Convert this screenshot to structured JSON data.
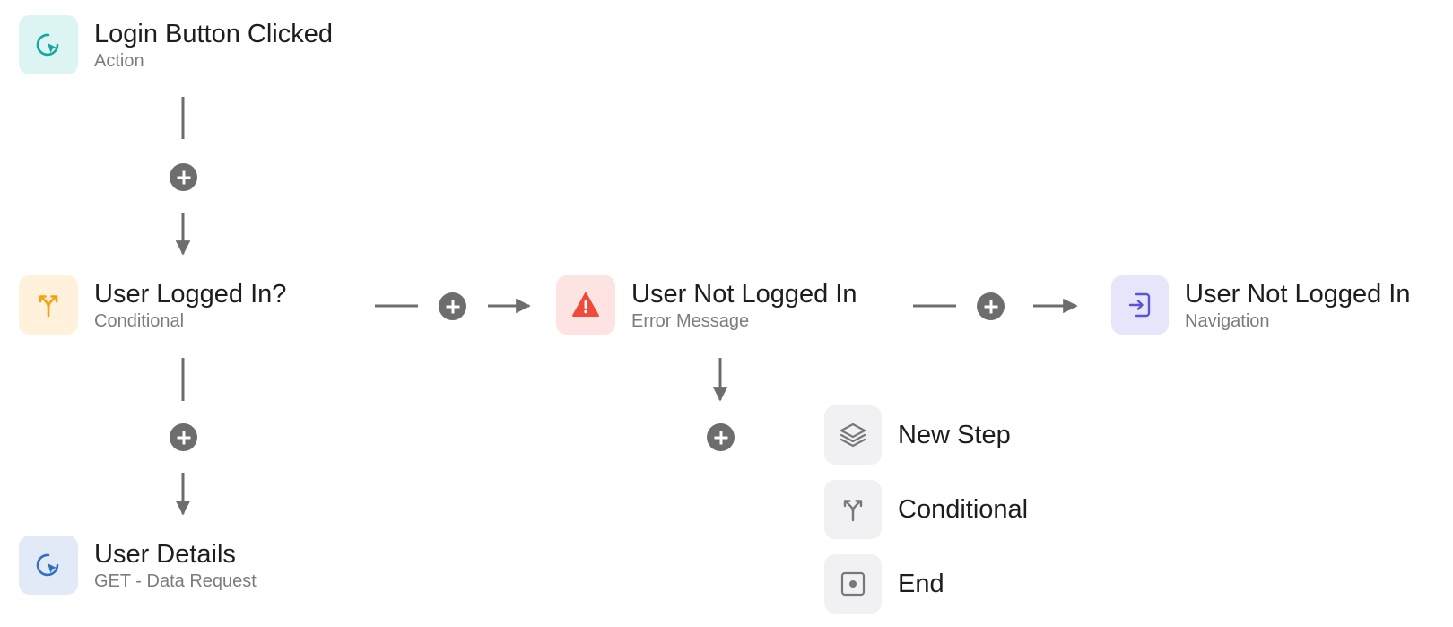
{
  "nodes": {
    "login_clicked": {
      "title": "Login Button Clicked",
      "subtitle": "Action",
      "icon": "cursor-click-icon",
      "icon_color": "#14a6a1",
      "icon_bg": "#dcf4f2"
    },
    "user_logged_in": {
      "title": "User Logged In?",
      "subtitle": "Conditional",
      "icon": "branch-icon",
      "icon_color": "#f5a010",
      "icon_bg": "#fff1dc"
    },
    "user_not_logged_in_error": {
      "title": "User Not Logged In",
      "subtitle": "Error Message",
      "icon": "warning-icon",
      "icon_color": "#ef4a3a",
      "icon_bg": "#fde3e1"
    },
    "user_not_logged_in_nav": {
      "title": "User Not Logged In",
      "subtitle": "Navigation",
      "icon": "sign-in-icon",
      "icon_color": "#5a55d6",
      "icon_bg": "#e6e5fa"
    },
    "user_details": {
      "title": "User Details",
      "subtitle": "GET - Data Request",
      "icon": "cursor-click-icon",
      "icon_color": "#2f6fc4",
      "icon_bg": "#e1eaf6"
    }
  },
  "add_step_menu": {
    "items": [
      {
        "label": "New Step",
        "icon": "layers-icon"
      },
      {
        "label": "Conditional",
        "icon": "branch-icon"
      },
      {
        "label": "End",
        "icon": "stop-square-icon"
      }
    ],
    "icon_color": "#77777c",
    "icon_bg": "#f1f1f3"
  },
  "connector_color": "#6d6d6d"
}
